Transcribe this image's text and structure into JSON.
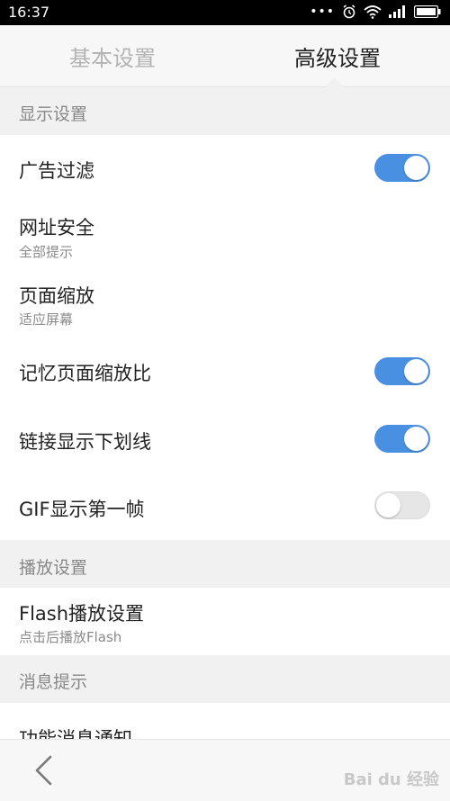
{
  "status_bar": {
    "time": "16:37"
  },
  "tabs": [
    {
      "label": "基本设置",
      "active": false
    },
    {
      "label": "高级设置",
      "active": true
    }
  ],
  "sections": {
    "display": "显示设置",
    "playback": "播放设置",
    "messages": "消息提示"
  },
  "settings": {
    "ad_filter": {
      "title": "广告过滤",
      "enabled": true
    },
    "url_security": {
      "title": "网址安全",
      "value": "全部提示"
    },
    "page_zoom": {
      "title": "页面缩放",
      "value": "适应屏幕"
    },
    "remember_zoom": {
      "title": "记忆页面缩放比",
      "enabled": true
    },
    "link_underline": {
      "title": "链接显示下划线",
      "enabled": true
    },
    "gif_first_frame": {
      "title": "GIF显示第一帧",
      "enabled": false
    },
    "flash_settings": {
      "title": "Flash播放设置",
      "value": "点击后播放Flash"
    },
    "feature_notifications": {
      "title": "功能消息通知"
    }
  },
  "watermark": "Bai du 经验",
  "colors": {
    "accent": "#4a90e2",
    "section_bg": "#f1f1f1"
  }
}
